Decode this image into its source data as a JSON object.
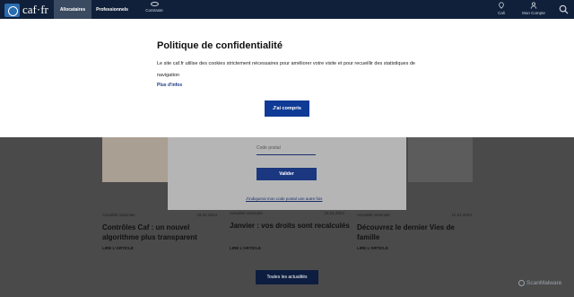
{
  "header": {
    "logo_text": "caf·fr",
    "tabs": [
      {
        "label": "Allocataires",
        "active": true
      },
      {
        "label": "Professionnels",
        "active": false
      }
    ],
    "contrast_label": "Contraste",
    "call_label": "Cali",
    "account_label": "Mon Compte"
  },
  "postal": {
    "placeholder": "Code postal",
    "validate_label": "Valider",
    "link_label": "J'indiquerai mon code postal une autre fois"
  },
  "articles": [
    {
      "category": "Actualité nationale",
      "date": "18.01.2024",
      "title": "Contrôles Caf : un nouvel algorithme plus transparent",
      "more": "LIRE L'ARTICLE"
    },
    {
      "category": "Actualité nationale",
      "date": "15.01.2024",
      "title": "Janvier : vos droits sont recalculés",
      "more": "LIRE L'ARTICLE"
    },
    {
      "category": "Actualité nationale",
      "date": "10.01.2024",
      "title": "Découvrez le dernier Vies de famille",
      "more": "LIRE L'ARTICLE"
    }
  ],
  "all_news_label": "Toutes les actualités",
  "watermark": "ScanMalware",
  "cookie": {
    "title": "Politique de confidentialité",
    "text": "Le site caf.fr utilise des cookies strictement nécessaires pour améliorer votre visite et pour recueillir des statistiques de navigation",
    "more_label": "Plus d'infos",
    "accept_label": "J'ai compris"
  },
  "colors": {
    "header_bg": "#10203a",
    "primary_button": "#0f3a96",
    "overlay": "#4a4a4a"
  }
}
